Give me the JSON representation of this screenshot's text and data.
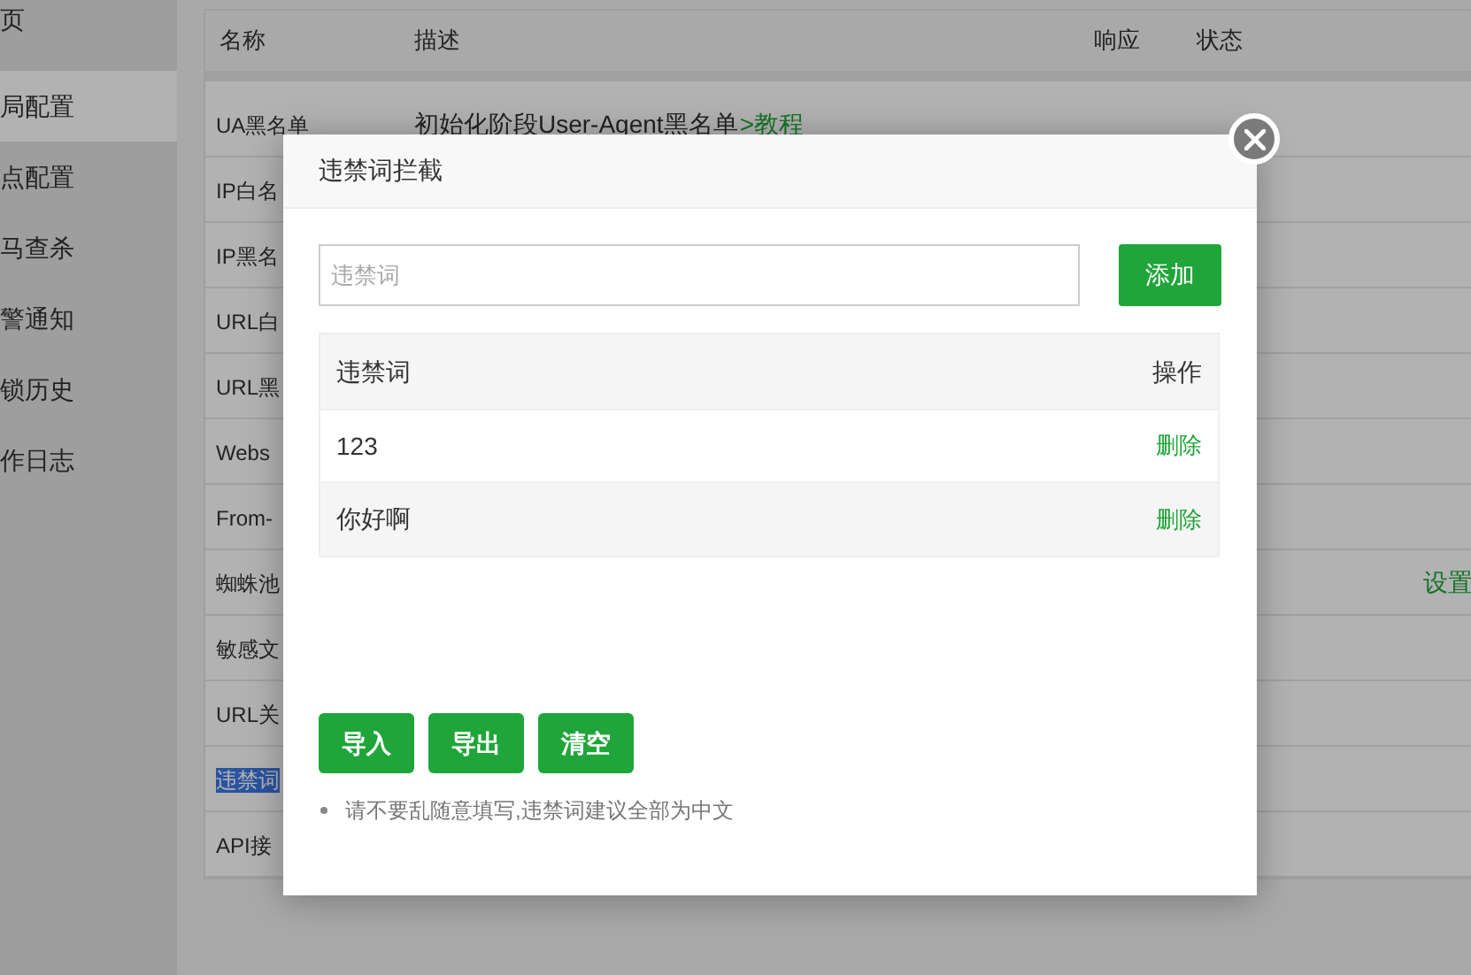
{
  "sidebar": {
    "items": [
      {
        "label": "页",
        "selected": false
      },
      {
        "label": "局配置",
        "selected": true
      },
      {
        "label": "点配置",
        "selected": false
      },
      {
        "label": "马查杀",
        "selected": false
      },
      {
        "label": "警通知",
        "selected": false
      },
      {
        "label": "锁历史",
        "selected": false
      },
      {
        "label": "作日志",
        "selected": false
      }
    ]
  },
  "table": {
    "columns": [
      "名称",
      "描述",
      "响应",
      "状态"
    ],
    "rows": [
      {
        "name": "UA黑名单",
        "description": "初始化阶段User-Agent黑名单",
        "link": ">教程",
        "highlighted": false
      },
      {
        "name": "IP白名",
        "highlighted": false
      },
      {
        "name": "IP黑名",
        "highlighted": false
      },
      {
        "name": "URL白",
        "highlighted": false
      },
      {
        "name": "URL黑",
        "highlighted": false
      },
      {
        "name": "Webs",
        "highlighted": false
      },
      {
        "name": "From-",
        "highlighted": false
      },
      {
        "name": "蜘蛛池",
        "action": "设置",
        "highlighted": false
      },
      {
        "name": "敏感文",
        "highlighted": false
      },
      {
        "name": "URL关",
        "highlighted": false
      },
      {
        "name": "违禁词",
        "highlighted": true
      },
      {
        "name": "API接",
        "highlighted": false
      }
    ]
  },
  "dialog": {
    "title": "违禁词拦截",
    "input": {
      "placeholder": "违禁词"
    },
    "add_button": "添加",
    "word_table": {
      "columns": [
        "违禁词",
        "操作"
      ],
      "rows": [
        {
          "word": "123",
          "action": "删除"
        },
        {
          "word": "你好啊",
          "action": "删除"
        }
      ]
    },
    "buttons": [
      "导入",
      "导出",
      "清空"
    ],
    "note": "请不要乱随意填写,违禁词建议全部为中文"
  }
}
